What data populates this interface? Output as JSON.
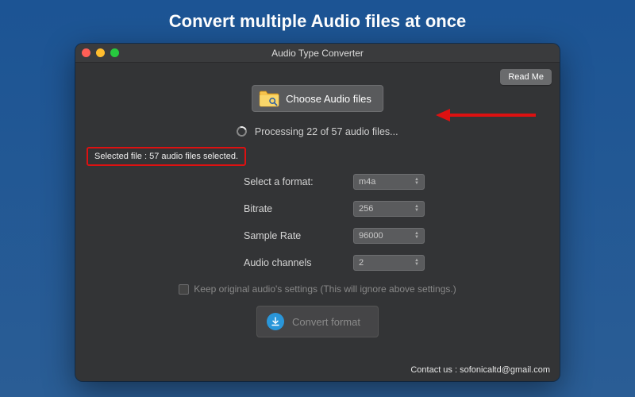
{
  "banner": "Convert multiple Audio files at once",
  "window": {
    "title": "Audio Type Converter",
    "readme_label": "Read Me",
    "choose_label": "Choose Audio files",
    "processing_text": "Processing 22 of 57 audio files...",
    "selected_text": "Selected file : 57 audio files selected.",
    "form": {
      "format_label": "Select a format:",
      "format_value": "m4a",
      "bitrate_label": "Bitrate",
      "bitrate_value": "256",
      "samplerate_label": "Sample Rate",
      "samplerate_value": "96000",
      "channels_label": "Audio channels",
      "channels_value": "2"
    },
    "keep_settings_label": "Keep original audio's settings (This will ignore above settings.)",
    "convert_label": "Convert format",
    "footer_prefix": "Contact us : ",
    "footer_email": "sofonicaltd@gmail.com"
  }
}
